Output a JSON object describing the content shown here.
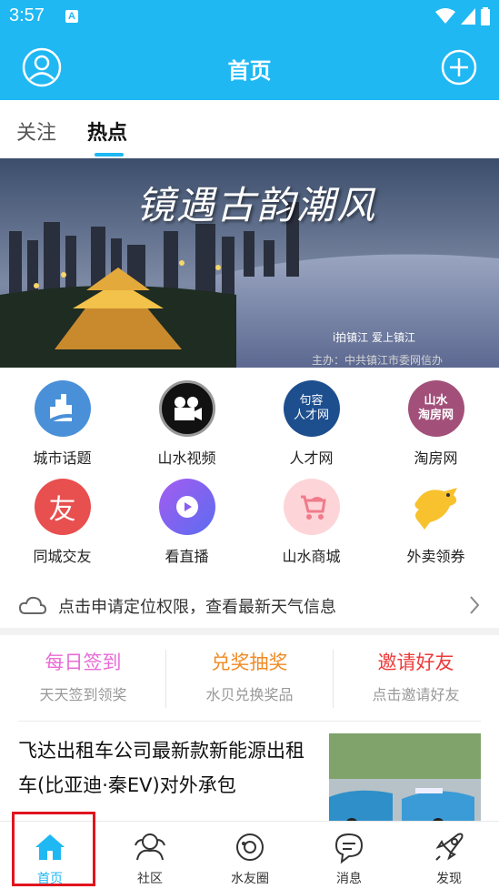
{
  "status_bar": {
    "time": "3:57",
    "badge": "A"
  },
  "header": {
    "title": "首页"
  },
  "tabs": [
    {
      "label": "关注"
    },
    {
      "label": "热点"
    }
  ],
  "banner": {
    "title": "镜遇古韵潮风",
    "subtitle": "i拍镇江  爱上镇江",
    "organizer": "主办：中共镇江市委网信办"
  },
  "grid": [
    {
      "label": "城市话题",
      "icon": "city-topic-icon"
    },
    {
      "label": "山水视频",
      "icon": "video-camera-icon"
    },
    {
      "label": "人才网",
      "icon": "talent-net-icon",
      "icon_text": "句容\n人才网"
    },
    {
      "label": "淘房网",
      "icon": "house-net-icon",
      "icon_text": "山水\n淘房网"
    },
    {
      "label": "同城交友",
      "icon": "friends-icon",
      "icon_text": "友"
    },
    {
      "label": "看直播",
      "icon": "play-icon"
    },
    {
      "label": "山水商城",
      "icon": "stroller-icon"
    },
    {
      "label": "外卖领券",
      "icon": "kangaroo-icon"
    }
  ],
  "weather": {
    "text": "点击申请定位权限，查看最新天气信息"
  },
  "actions": [
    {
      "title": "每日签到",
      "sub": "天天签到领奖",
      "color": "#e96bd6"
    },
    {
      "title": "兑奖抽奖",
      "sub": "水贝兑换奖品",
      "color": "#f08a24"
    },
    {
      "title": "邀请好友",
      "sub": "点击邀请好友",
      "color": "#ee3b3b"
    }
  ],
  "news": {
    "headline": "飞达出租车公司最新款新能源出租车(比亚迪·秦EV)对外承包"
  },
  "tabbar": [
    {
      "label": "首页",
      "active": true
    },
    {
      "label": "社区"
    },
    {
      "label": "水友圈"
    },
    {
      "label": "消息"
    },
    {
      "label": "发现"
    }
  ],
  "colors": {
    "primary": "#1fb8f3",
    "highlight": "#e0141e"
  }
}
